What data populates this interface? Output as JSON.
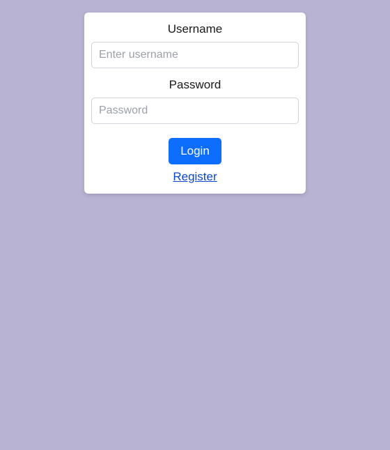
{
  "form": {
    "username_label": "Username",
    "username_placeholder": "Enter username",
    "username_value": "",
    "password_label": "Password",
    "password_placeholder": "Password",
    "password_value": "",
    "login_button": "Login",
    "register_link": "Register"
  },
  "colors": {
    "page_bg": "#b8b3d3",
    "card_bg": "#ffffff",
    "primary_button": "#0d6efd",
    "link": "#0d47c9"
  }
}
